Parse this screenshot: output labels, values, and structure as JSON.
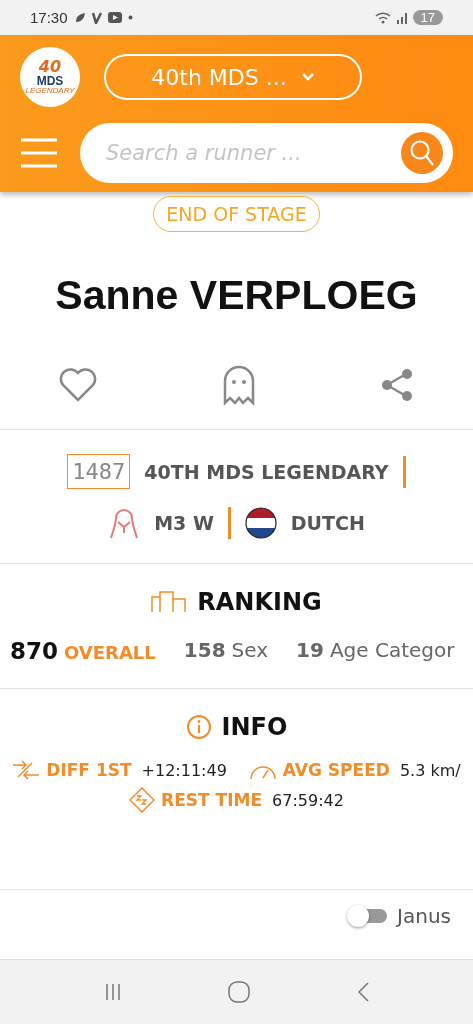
{
  "status_bar": {
    "time": "17:30",
    "battery": "17"
  },
  "header": {
    "logo": {
      "number": "40",
      "name": "MDS",
      "subtitle": "LEGENDARY"
    },
    "race_select": "40th MDS ...",
    "search": {
      "placeholder": "Search a runner ..."
    }
  },
  "stage_badge": "END OF STAGE",
  "runner": {
    "name": "Sanne VERPLOEG",
    "bib": "1487",
    "race": "40TH MDS LEGENDARY",
    "category": "M3 W",
    "nationality": "DUTCH"
  },
  "ranking": {
    "title": "RANKING",
    "items": [
      {
        "kind": "main",
        "rank": "870",
        "category": "OVERALL"
      },
      {
        "kind": "sub",
        "rank": "158",
        "category": "Sex"
      },
      {
        "kind": "sub",
        "rank": "19",
        "category": "Age Categor"
      }
    ]
  },
  "info": {
    "title": "INFO",
    "items": [
      {
        "kind": "diff",
        "label": "DIFF 1ST",
        "value": "+12:11:49"
      },
      {
        "kind": "speed",
        "label": "AVG SPEED",
        "value": "5.3 km/"
      },
      {
        "kind": "rest",
        "label": "REST TIME",
        "value": "67:59:42"
      }
    ]
  },
  "janus_toggle": {
    "label": "Janus",
    "on": false
  }
}
